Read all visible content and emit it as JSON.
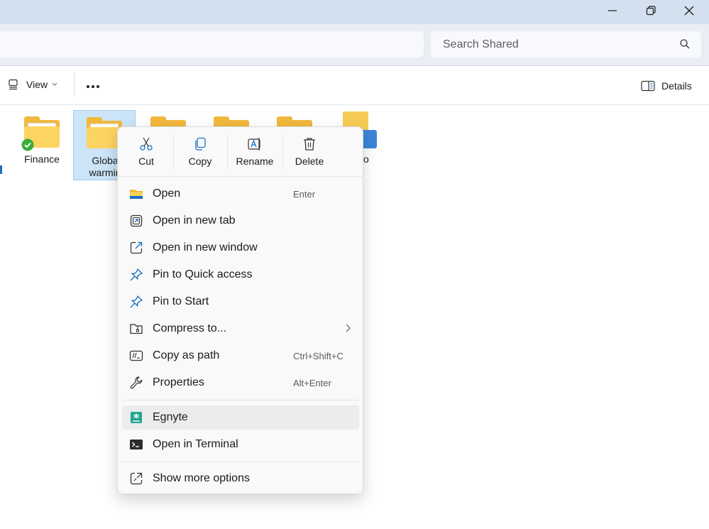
{
  "window": {
    "controls": [
      "minimize",
      "maximize",
      "close"
    ]
  },
  "search": {
    "placeholder": "Search Shared"
  },
  "toolbar": {
    "view_label": "View",
    "details_label": "Details"
  },
  "folders": [
    {
      "label": "Finance",
      "synced": true
    },
    {
      "label_line1": "Globa",
      "label_line2": "warmin",
      "selected": true
    },
    {
      "label": "o"
    }
  ],
  "context_menu": {
    "quick_actions": [
      {
        "label": "Cut",
        "icon": "scissors-icon"
      },
      {
        "label": "Copy",
        "icon": "copy-icon"
      },
      {
        "label": "Rename",
        "icon": "rename-icon"
      },
      {
        "label": "Delete",
        "icon": "trash-icon"
      }
    ],
    "items": [
      {
        "label": "Open",
        "shortcut": "Enter",
        "icon": "folder-open-icon"
      },
      {
        "label": "Open in new tab",
        "shortcut": "",
        "icon": "new-tab-icon"
      },
      {
        "label": "Open in new window",
        "shortcut": "",
        "icon": "new-window-icon"
      },
      {
        "label": "Pin to Quick access",
        "shortcut": "",
        "icon": "pin-icon"
      },
      {
        "label": "Pin to Start",
        "shortcut": "",
        "icon": "pin-icon"
      },
      {
        "label": "Compress to...",
        "shortcut": "",
        "icon": "zip-folder-icon",
        "submenu": true
      },
      {
        "label": "Copy as path",
        "shortcut": "Ctrl+Shift+C",
        "icon": "copy-path-icon"
      },
      {
        "label": "Properties",
        "shortcut": "Alt+Enter",
        "icon": "wrench-icon"
      },
      {
        "label": "Egnyte",
        "shortcut": "",
        "icon": "egnyte-icon",
        "highlighted": true
      },
      {
        "label": "Open in Terminal",
        "shortcut": "",
        "icon": "terminal-icon"
      },
      {
        "label": "Show more options",
        "shortcut": "",
        "icon": "more-options-icon"
      }
    ]
  },
  "colors": {
    "titlebar": "#d3e0ef",
    "folder": "#fcd462",
    "accent_blue": "#1a6fc4",
    "egnyte_green": "#1fa58f"
  }
}
